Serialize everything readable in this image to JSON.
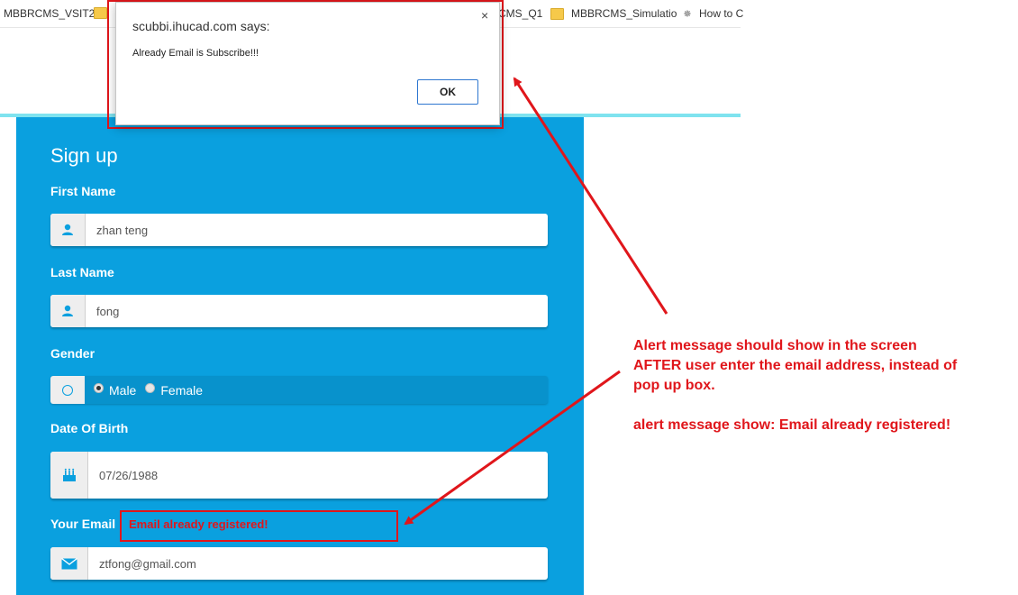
{
  "bookmarks": [
    {
      "label": "MBBRCMS_VSIT2",
      "icon": "none"
    },
    {
      "label": "",
      "icon": "folder-icon"
    },
    {
      "label": "CMS_Q1",
      "icon": "none"
    },
    {
      "label": "MBBRCMS_Simulatio",
      "icon": "folder-icon"
    },
    {
      "label": "How to C",
      "icon": "gear-icon"
    }
  ],
  "alert": {
    "title": "scubbi.ihucad.com says:",
    "message": "Already Email is Subscribe!!!",
    "ok_label": "OK",
    "close_label": "×"
  },
  "form": {
    "title": "Sign up",
    "first_name": {
      "label": "First Name",
      "value": "zhan teng",
      "icon": "user-icon"
    },
    "last_name": {
      "label": "Last Name",
      "value": "fong",
      "icon": "user-icon"
    },
    "gender": {
      "label": "Gender",
      "options": [
        "Male",
        "Female"
      ],
      "selected": "Male",
      "icon": "radio-circle-icon"
    },
    "dob": {
      "label": "Date Of Birth",
      "value": "07/26/1988",
      "icon": "birthday-cake-icon"
    },
    "email": {
      "label": "Your Email",
      "value": "ztfong@gmail.com",
      "error": "Email already registered!",
      "icon": "envelope-icon"
    }
  },
  "annotation": {
    "line1": "Alert message should show in the screen",
    "line2": "AFTER user enter the email address, instead of",
    "line3": "pop up box.",
    "line4": "alert message show: Email already registered!"
  },
  "colors": {
    "panel": "#0aa0df",
    "annotation_red": "#e0161b",
    "accent_line": "#7fe3ef"
  }
}
